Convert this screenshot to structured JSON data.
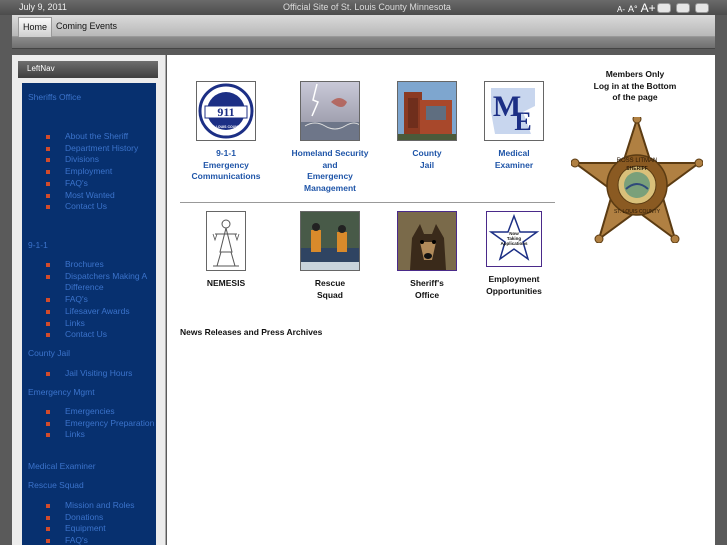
{
  "topbar": {
    "date": "July 9, 2011",
    "site_title": "Official Site of St. Louis County Minnesota",
    "font_small": "A-",
    "font_reset": "A°",
    "font_large": "A+"
  },
  "menu": {
    "items": [
      {
        "label": "Home"
      },
      {
        "label": "Coming Events"
      }
    ]
  },
  "leftnav": {
    "title": "LeftNav",
    "sections": [
      {
        "label": "Sheriffs Office",
        "items": [
          "About the Sheriff",
          "Department History",
          "Divisions",
          "Employment",
          "FAQ's",
          "Most Wanted",
          "Contact Us"
        ]
      },
      {
        "label": "9-1-1",
        "items": [
          "Brochures",
          "Dispatchers Making A Difference",
          "FAQ's",
          "Lifesaver Awards",
          "Links",
          "Contact Us"
        ]
      },
      {
        "label": "County Jail",
        "items": [
          "Jail Visiting Hours"
        ]
      },
      {
        "label": "Emergency Mgmt",
        "items": [
          "Emergencies",
          "Emergency Preparation",
          "Links"
        ]
      },
      {
        "label": "Medical Examiner",
        "items": []
      },
      {
        "label": "Rescue Squad",
        "items": [
          "Mission and Roles",
          "Donations",
          "Equipment",
          "FAQ's"
        ]
      }
    ]
  },
  "tiles": {
    "t911": {
      "label": "9-1-1\nEmergency\nCommunications",
      "seal_text": "911",
      "seal_sub": "ST. LOUIS COUNTY"
    },
    "homeland": {
      "label": "Homeland Security\nand\nEmergency\nManagement"
    },
    "jail": {
      "label": "County\nJail"
    },
    "medical": {
      "label": "Medical\nExaminer",
      "logo_m": "M",
      "logo_e": "E"
    },
    "nemesis": {
      "label": "NEMESIS"
    },
    "rescue": {
      "label": "Rescue\nSquad"
    },
    "sheriff": {
      "label": "Sheriff's\nOffice"
    },
    "employment": {
      "label": "Employment\nOpportunities",
      "star_text": "Now\nTaking\nApplications"
    }
  },
  "news": {
    "label": "News Releases and Press Archives"
  },
  "members": {
    "text": "Members Only\nLog in at the Bottom\nof the page"
  },
  "badge": {
    "top_text": "ROSS LITMAN",
    "mid_text": "SHERIFF",
    "bottom_text": "ST. LOUIS COUNTY"
  },
  "colors": {
    "nav_bg": "#07306f",
    "nav_link": "#3b73cb",
    "tile_link": "#1f55a8",
    "bullet": "#d24b2b",
    "badge_gold": "#b08042"
  }
}
